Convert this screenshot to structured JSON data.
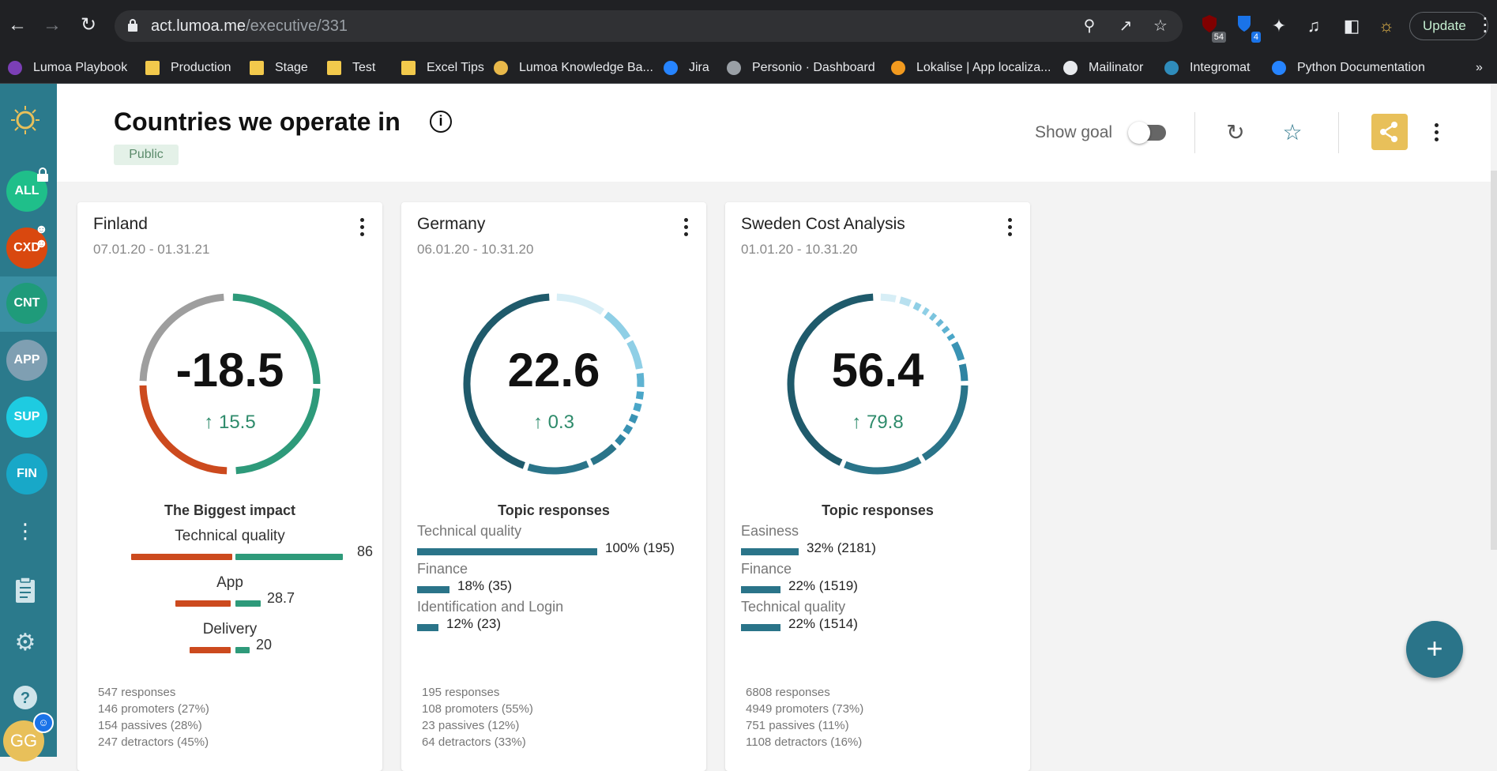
{
  "browser": {
    "url_host": "act.lumoa.me",
    "url_path": "/executive/331",
    "update_label": "Update",
    "extension_counts": [
      "54",
      "4"
    ],
    "bookmarks": [
      {
        "label": "Lumoa Playbook",
        "icon": "onenote-icon"
      },
      {
        "label": "Production",
        "icon": "folder-icon"
      },
      {
        "label": "Stage",
        "icon": "folder-icon"
      },
      {
        "label": "Test",
        "icon": "folder-icon"
      },
      {
        "label": "Excel Tips",
        "icon": "folder-icon"
      },
      {
        "label": "Lumoa Knowledge Ba...",
        "icon": "circle-icon"
      },
      {
        "label": "Jira",
        "icon": "jira-icon"
      },
      {
        "label": "Personio · Dashboard",
        "icon": "personio-icon"
      },
      {
        "label": "Lokalise | App localiza...",
        "icon": "lokalise-icon"
      },
      {
        "label": "Mailinator",
        "icon": "globe-icon"
      },
      {
        "label": "Integromat",
        "icon": "integromat-icon"
      },
      {
        "label": "Python Documentation",
        "icon": "confluence-icon"
      }
    ]
  },
  "rail": {
    "items": [
      {
        "label": "ALL",
        "color": "#1fbf8a"
      },
      {
        "label": "CXD",
        "color": "#d9480f"
      },
      {
        "label": "CNT",
        "color": "#1f9b7a"
      },
      {
        "label": "APP",
        "color": "#7f9fb2"
      },
      {
        "label": "SUP",
        "color": "#1ecbe1"
      },
      {
        "label": "FIN",
        "color": "#18a8c8"
      }
    ],
    "avatar": "GG"
  },
  "header": {
    "title": "Countries we operate in",
    "badge": "Public",
    "show_goal_label": "Show goal"
  },
  "cards": [
    {
      "title": "Finland",
      "date": "07.01.20 - 01.31.21",
      "score": "-18.5",
      "change": "15.5",
      "section_title": "The Biggest impact",
      "impacts": [
        {
          "label": "Technical quality",
          "value": "86"
        },
        {
          "label": "App",
          "value": "28.7"
        },
        {
          "label": "Delivery",
          "value": "20"
        }
      ],
      "stats": [
        "547 responses",
        "146 promoters (27%)",
        "154 passives (28%)",
        "247 detractors (45%)"
      ]
    },
    {
      "title": "Germany",
      "date": "06.01.20 - 10.31.20",
      "score": "22.6",
      "change": "0.3",
      "section_title": "Topic responses",
      "topics": [
        {
          "label": "Technical quality",
          "value": "100% (195)",
          "share": 1.0
        },
        {
          "label": "Finance",
          "value": "18% (35)",
          "share": 0.18
        },
        {
          "label": "Identification and Login",
          "value": "12% (23)",
          "share": 0.12
        }
      ],
      "stats": [
        "195 responses",
        "108 promoters (55%)",
        "23 passives (12%)",
        "64 detractors (33%)"
      ]
    },
    {
      "title": "Sweden Cost Analysis",
      "date": "01.01.20 - 10.31.20",
      "score": "56.4",
      "change": "79.8",
      "section_title": "Topic responses",
      "topics": [
        {
          "label": "Easiness",
          "value": "32% (2181)",
          "share": 0.32
        },
        {
          "label": "Finance",
          "value": "22% (1519)",
          "share": 0.22
        },
        {
          "label": "Technical quality",
          "value": "22% (1514)",
          "share": 0.22
        }
      ],
      "stats": [
        "6808 responses",
        "4949 promoters (73%)",
        "751 passives (11%)",
        "1108 detractors (16%)"
      ]
    }
  ],
  "colors": {
    "accent": "#2a7489",
    "negative": "#cc4a1e",
    "positive": "#2e9a7a",
    "share_button": "#e8c05a"
  }
}
